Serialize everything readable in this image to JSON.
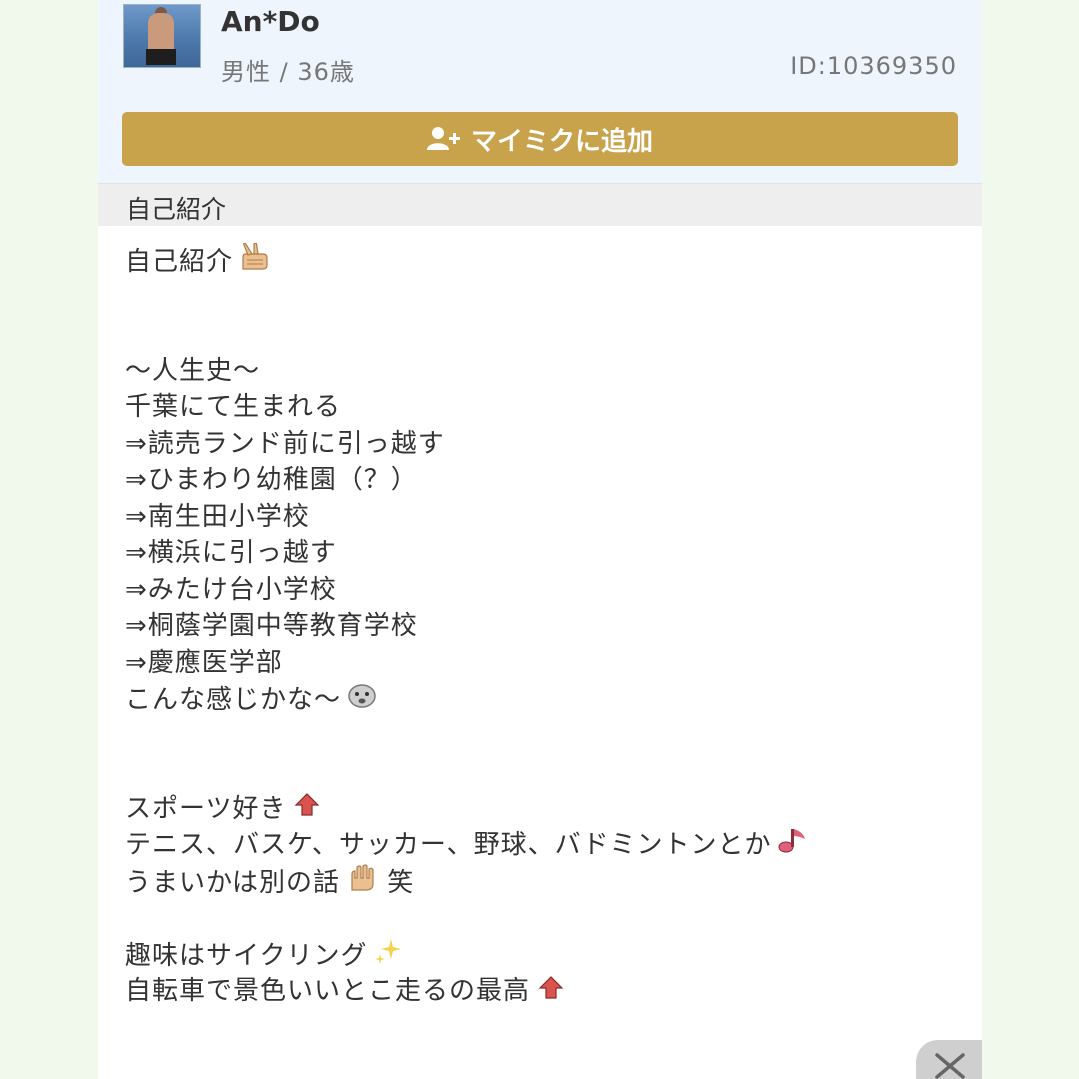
{
  "profile": {
    "name": "An*Do",
    "meta": "男性 / 36歳",
    "id": "ID:10369350",
    "add_button": "マイミクに追加"
  },
  "section": {
    "title": "自己紹介"
  },
  "intro": {
    "heading": "自己紹介",
    "history_title": "〜人生史〜",
    "line1": "千葉にて生まれる",
    "line2": "⇒読売ランド前に引っ越す",
    "line3": "⇒ひまわり幼稚園（？）",
    "line4": "⇒南生田小学校",
    "line5": "⇒横浜に引っ越す",
    "line6": "⇒みたけ台小学校",
    "line7": "⇒桐蔭学園中等教育学校",
    "line8": "⇒慶應医学部",
    "line9": "こんな感じかな〜",
    "sports": "スポーツ好き",
    "sports_list": "テニス、バスケ、サッカー、野球、バドミントンとか",
    "skill": "うまいかは別の話",
    "skill_suffix": "笑",
    "hobby": "趣味はサイクリング",
    "bike": "自転車で景色いいとこ走るの最高"
  },
  "icons": {
    "add_user": "add-user-icon",
    "peace": "peace-sign-emoji",
    "face": "face-emoji",
    "up_arrow": "up-arrow-emoji",
    "note": "music-note-emoji",
    "hand": "raised-hand-emoji",
    "sparkle": "sparkle-emoji",
    "close": "close-icon"
  },
  "colors": {
    "button": "#c9a24c",
    "header_bg": "#eef5fc",
    "section_bg": "#eeeeee",
    "page_bg": "#f1f8ec"
  }
}
